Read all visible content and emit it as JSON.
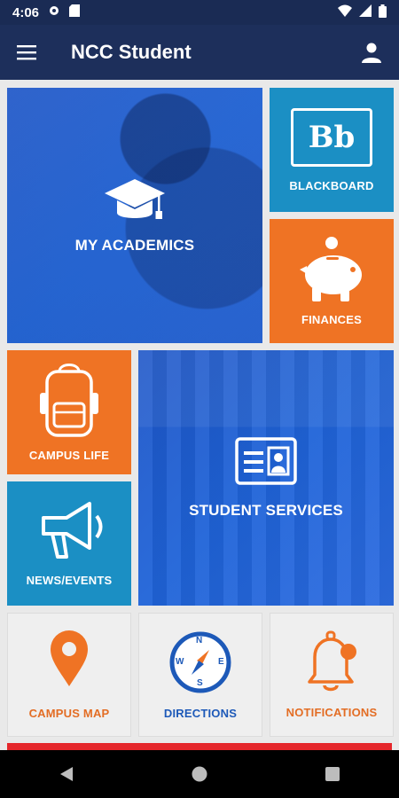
{
  "status_bar": {
    "time": "4:06",
    "icons": [
      "gear-icon",
      "sd-card-icon",
      "wifi-icon",
      "cell-signal-icon",
      "battery-icon"
    ]
  },
  "app_bar": {
    "title": "NCC Student",
    "menu_icon": "hamburger-menu-icon",
    "profile_icon": "person-icon"
  },
  "tiles": {
    "academics": {
      "label": "MY ACADEMICS",
      "icon": "graduation-cap-icon"
    },
    "blackboard": {
      "label": "BLACKBOARD",
      "icon": "blackboard-logo",
      "logo_text": "Bb"
    },
    "finances": {
      "label": "FINANCES",
      "icon": "piggy-bank-icon"
    },
    "campus_life": {
      "label": "CAMPUS LIFE",
      "icon": "backpack-icon"
    },
    "student_services": {
      "label": "STUDENT SERVICES",
      "icon": "id-card-icon"
    },
    "news_events": {
      "label": "NEWS/EVENTS",
      "icon": "megaphone-icon"
    },
    "campus_map": {
      "label": "CAMPUS MAP",
      "icon": "map-pin-icon"
    },
    "directions": {
      "label": "DIRECTIONS",
      "icon": "compass-icon",
      "compass": {
        "n": "N",
        "e": "E",
        "s": "S",
        "w": "W"
      }
    },
    "notifications": {
      "label": "NOTIFICATIONS",
      "icon": "bell-icon"
    }
  },
  "colors": {
    "app_bar": "#1d2f5b",
    "blue": "#1f63d8",
    "teal": "#1b8fc4",
    "orange": "#ef7324",
    "accent_red": "#e5262b"
  },
  "nav_bar": {
    "icons": [
      "back-icon",
      "home-icon",
      "recents-icon"
    ]
  }
}
